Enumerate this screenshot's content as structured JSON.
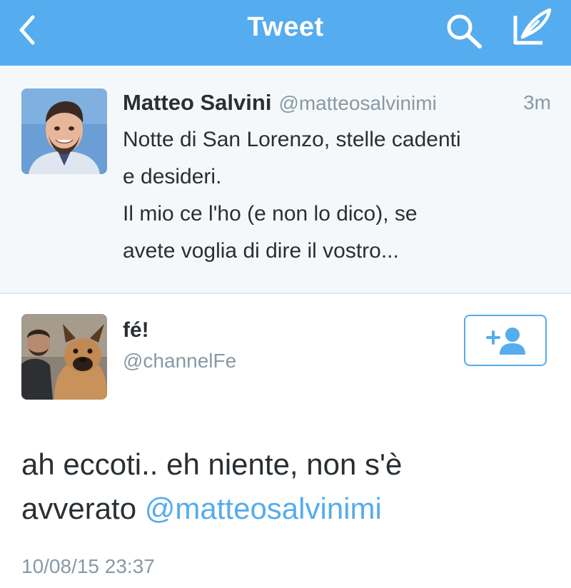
{
  "navbar": {
    "title": "Tweet",
    "background": "#55acee",
    "icons": [
      "back-chevron-icon",
      "search-icon",
      "compose-icon"
    ]
  },
  "parent_tweet": {
    "name": "Matteo Salvini",
    "handle": "@matteosalvinimi",
    "time": "3m",
    "lines": [
      "Notte di San Lorenzo, stelle cadenti",
      "e desideri.",
      "Il mio ce l'ho (e non lo dico), se",
      "avete voglia di dire il vostro..."
    ]
  },
  "reply_tweet": {
    "name": "fé!",
    "handle": "@channelFe",
    "follow_icon": "follow-user-icon",
    "text_line1": "ah eccoti.. eh niente, non s'è",
    "text_line2_prefix": "avverato ",
    "mention": "@matteosalvinimi",
    "timestamp": "10/08/15 23:37"
  },
  "colors": {
    "accent": "#55acee",
    "text": "#292f33",
    "muted": "#8899a6",
    "parent_bg": "#f5f8fa"
  }
}
